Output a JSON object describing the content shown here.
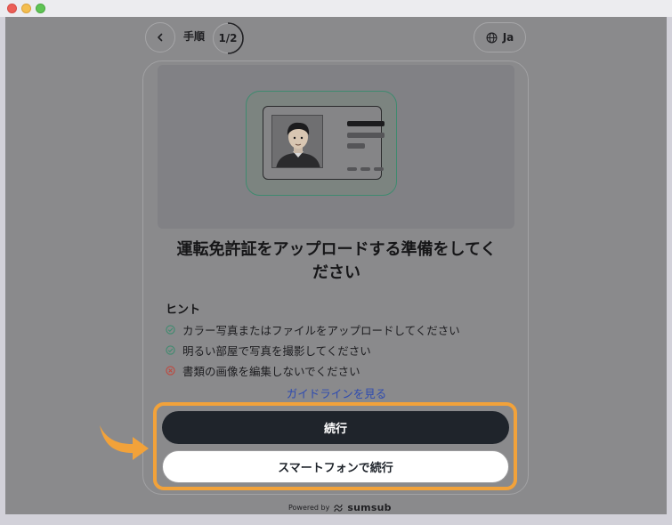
{
  "header": {
    "back_icon": "chevron-left-icon",
    "step_label": "手順",
    "step_counter": "1/2",
    "language": "Ja",
    "globe_icon": "globe-icon"
  },
  "card": {
    "illustration": "id-card-icon",
    "heading_line1": "運転免許証をアップロードする準備をしてく",
    "heading_line2": "ださい",
    "hints_title": "ヒント",
    "hints": [
      {
        "text": "カラー写真またはファイルをアップロードしてください",
        "icon": "check-circle-icon",
        "color": "#3f8a6f"
      },
      {
        "text": "明るい部屋で写真を撮影してください",
        "icon": "check-circle-icon",
        "color": "#3f8a6f"
      },
      {
        "text": "書類の画像を編集しないでください",
        "icon": "x-circle-icon",
        "color": "#c0473d"
      }
    ],
    "guidelines_link": "ガイドラインを見る"
  },
  "actions": {
    "continue_label": "続行",
    "continue_on_phone_label": "スマートフォンで続行",
    "highlight_color": "#f2a23a"
  },
  "footer": {
    "powered_by": "Powered by",
    "brand": "sumsub"
  }
}
